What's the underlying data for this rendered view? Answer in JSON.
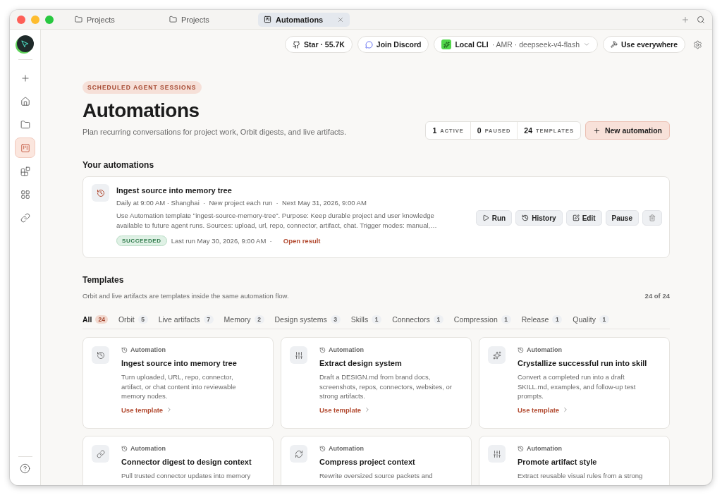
{
  "window": {
    "tabs": [
      {
        "label": "Projects",
        "selected": false
      },
      {
        "label": "Projects",
        "selected": false
      },
      {
        "label": "Automations",
        "selected": true
      }
    ]
  },
  "topbar": {
    "star": "Star · 55.7K",
    "discord": "Join Discord",
    "cli": {
      "name": "Local CLI",
      "detail": "· AMR · deepseek-v4-flash"
    },
    "use_everywhere": "Use everywhere"
  },
  "sidebar": {
    "items": [
      {
        "kind": "new",
        "selected": false
      },
      {
        "kind": "home",
        "selected": false
      },
      {
        "kind": "folder",
        "selected": false
      },
      {
        "kind": "board",
        "selected": true
      },
      {
        "kind": "blocks",
        "selected": false
      },
      {
        "kind": "grid",
        "selected": false
      },
      {
        "kind": "link",
        "selected": false
      }
    ]
  },
  "header": {
    "eyebrow": "SCHEDULED AGENT SESSIONS",
    "title": "Automations",
    "subtitle": "Plan recurring conversations for project work, Orbit digests, and live artifacts.",
    "stats": [
      {
        "value": "1",
        "label": "ACTIVE"
      },
      {
        "value": "0",
        "label": "PAUSED"
      },
      {
        "value": "24",
        "label": "TEMPLATES"
      }
    ],
    "new_button": "New automation"
  },
  "automations": {
    "heading": "Your automations",
    "items": [
      {
        "title": "Ingest source into memory tree",
        "meta": "Daily at 9:00 AM · Shanghai  ·  New project each run  ·  Next May 31, 2026, 9:00 AM",
        "description": "Use Automation template \"ingest-source-memory-tree\". Purpose: Keep durable project and user knowledge available to future agent runs. Sources: upload, url, repo, connector, artifact, chat. Trigger modes: manual,…",
        "status": "SUCCEEDED",
        "last_run": "Last run May 30, 2026, 9:00 AM  ·",
        "link": "Open result",
        "actions": [
          {
            "kind": "run",
            "label": "Run"
          },
          {
            "kind": "history",
            "label": "History"
          },
          {
            "kind": "edit",
            "label": "Edit"
          },
          {
            "kind": "plain",
            "label": "Pause"
          },
          {
            "kind": "delete"
          }
        ]
      }
    ]
  },
  "templates": {
    "heading": "Templates",
    "subtitle": "Orbit and live artifacts are templates inside the same automation flow.",
    "count": "24 of 24",
    "filters": [
      {
        "label": "All",
        "count": "24",
        "selected": true
      },
      {
        "label": "Orbit",
        "count": "5",
        "selected": false
      },
      {
        "label": "Live artifacts",
        "count": "7",
        "selected": false
      },
      {
        "label": "Memory",
        "count": "2",
        "selected": false
      },
      {
        "label": "Design systems",
        "count": "3",
        "selected": false
      },
      {
        "label": "Skills",
        "count": "1",
        "selected": false
      },
      {
        "label": "Connectors",
        "count": "1",
        "selected": false
      },
      {
        "label": "Compression",
        "count": "1",
        "selected": false
      },
      {
        "label": "Release",
        "count": "1",
        "selected": false
      },
      {
        "label": "Quality",
        "count": "1",
        "selected": false
      }
    ],
    "cards": [
      {
        "kind": "history",
        "tag": "Automation",
        "title": "Ingest source into memory tree",
        "description": "Turn uploaded, URL, repo, connector, artifact, or chat content into reviewable memory nodes.",
        "link": "Use template"
      },
      {
        "kind": "sliders",
        "tag": "Automation",
        "title": "Extract design system",
        "description": "Draft a DESIGN.md from brand docs, screenshots, repos, connectors, websites, or strong artifacts.",
        "link": "Use template"
      },
      {
        "kind": "sparkles",
        "tag": "Automation",
        "title": "Crystallize successful run into skill",
        "description": "Convert a completed run into a draft SKILL.md, examples, and follow-up test prompts.",
        "link": "Use template"
      },
      {
        "kind": "link",
        "tag": "Automation",
        "title": "Connector digest to design context",
        "description": "Pull trusted connector updates into memory"
      },
      {
        "kind": "refresh",
        "tag": "Automation",
        "title": "Compress project context",
        "description": "Rewrite oversized source packets and"
      },
      {
        "kind": "sliders",
        "tag": "Automation",
        "title": "Promote artifact style",
        "description": "Extract reusable visual rules from a strong"
      }
    ]
  }
}
